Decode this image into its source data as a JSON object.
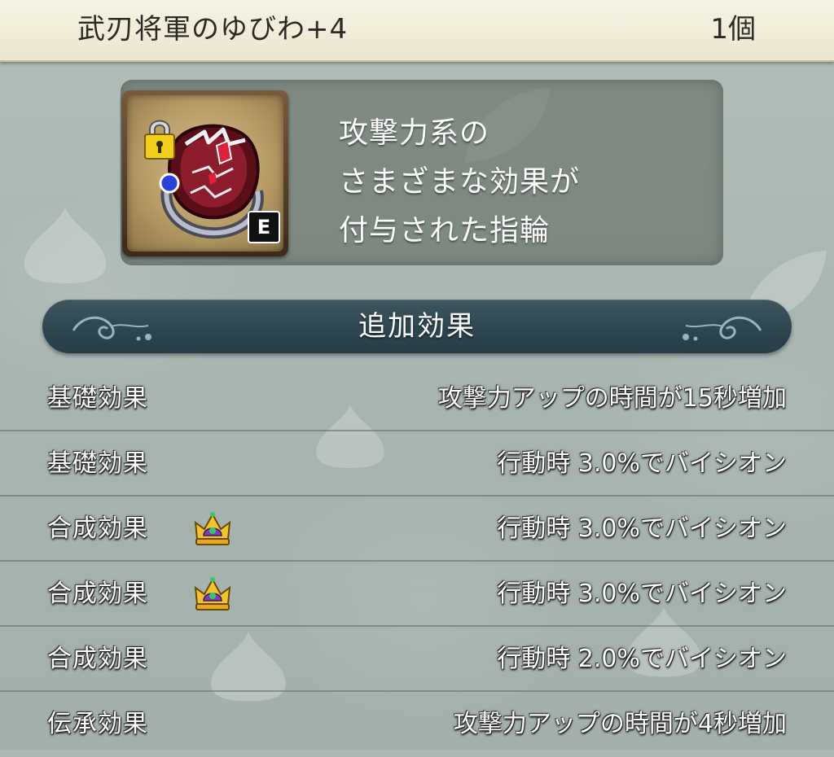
{
  "header": {
    "item_name": "武刃将軍のゆびわ+4",
    "count": "1個"
  },
  "item": {
    "icon": "ring-icon",
    "lock_icon": "padlock-icon",
    "equipped_badge": "E",
    "description_lines": [
      "攻撃力系の",
      "さまざまな効果が",
      "付与された指輪"
    ]
  },
  "section": {
    "title": "追加効果"
  },
  "effects": [
    {
      "label": "基礎効果",
      "value": "攻撃力アップの時間が15秒増加",
      "crown": false
    },
    {
      "label": "基礎効果",
      "value": "行動時 3.0%でバイシオン",
      "crown": false
    },
    {
      "label": "合成効果",
      "value": "行動時 3.0%でバイシオン",
      "crown": true
    },
    {
      "label": "合成効果",
      "value": "行動時 3.0%でバイシオン",
      "crown": true
    },
    {
      "label": "合成効果",
      "value": "行動時 2.0%でバイシオン",
      "crown": false
    },
    {
      "label": "伝承効果",
      "value": "攻撃力アップの時間が4秒増加",
      "crown": false
    }
  ],
  "colors": {
    "header_bg": "#f1edd9",
    "banner_bg": "#2e4650",
    "panel_bg": "#5c6658",
    "crown_gold": "#f2c230",
    "crown_purple": "#7a3fb0"
  }
}
